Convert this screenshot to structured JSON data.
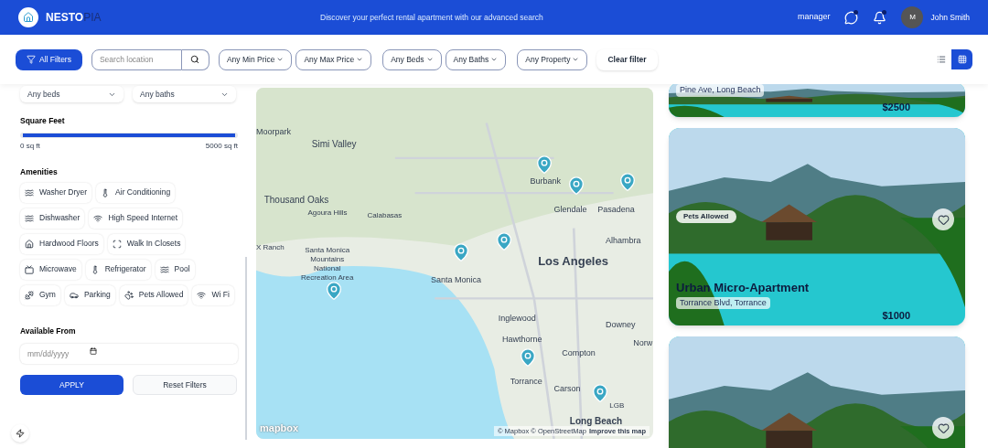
{
  "header": {
    "brand_main": "NESTO",
    "brand_accent": "PIA",
    "tagline": "Discover your perfect rental apartment with our advanced search",
    "role": "manager",
    "user_initial": "M",
    "user_name": "John Smith"
  },
  "toolbar": {
    "all_filters": "All Filters",
    "search": {
      "placeholder": "Search location"
    },
    "dropdowns": [
      "Any Min Price",
      "Any Max Price",
      "Any Beds",
      "Any Baths",
      "Any Property"
    ],
    "clear": "Clear filter",
    "views": [
      {
        "kind": "list",
        "selected": false
      },
      {
        "kind": "grid",
        "selected": true
      }
    ]
  },
  "sidebar": {
    "selects": [
      "Any beds",
      "Any baths"
    ],
    "square_feet": {
      "title": "Square Feet",
      "level": 1,
      "min": "0 sq ft",
      "max": "5000 sq ft"
    },
    "amenities_title": "Amenities",
    "amenities": [
      {
        "label": "Washer Dryer",
        "kind": "waves"
      },
      {
        "label": "Air Conditioning",
        "kind": "thermometer"
      },
      {
        "label": "Dishwasher",
        "kind": "waves"
      },
      {
        "label": "High Speed Internet",
        "kind": "wifi"
      },
      {
        "label": "Hardwood Floors",
        "kind": "home"
      },
      {
        "label": "Walk In Closets",
        "kind": "frame"
      },
      {
        "label": "Microwave",
        "kind": "tv"
      },
      {
        "label": "Refrigerator",
        "kind": "thermometer"
      },
      {
        "label": "Pool",
        "kind": "waves"
      },
      {
        "label": "Gym",
        "kind": "gym"
      },
      {
        "label": "Parking",
        "kind": "car"
      },
      {
        "label": "Pets Allowed",
        "kind": "paw"
      },
      {
        "label": "Wi Fi",
        "kind": "wifi"
      }
    ],
    "available_title": "Available From",
    "date": {
      "placeholder": "mm/dd/yyyy"
    },
    "apply": "APPLY",
    "reset": "Reset Filters"
  },
  "map": {
    "labels": [
      "Moorpark",
      "Simi Valley",
      "Thousand Oaks",
      "Agoura Hills",
      "Calabasas",
      "X Ranch",
      "Santa Monica Mountains National Recreation Area",
      "Burbank",
      "Glendale",
      "Pasadena",
      "Alhambra",
      "Los Angeles",
      "Santa Monica",
      "Inglewood",
      "Downey",
      "Hawthorne",
      "Norw",
      "Compton",
      "Torrance",
      "Carson",
      "LGB",
      "Long Beach"
    ],
    "logo": "mapbox",
    "attribution": "© Mapbox © OpenStreetMap",
    "improve": "Improve this map"
  },
  "listings": [
    {
      "address": "Pine Ave, Long Beach",
      "price": "$2500"
    },
    {
      "tag": "Pets Allowed",
      "title": "Urban Micro-Apartment",
      "address": "Torrance Blvd, Torrance",
      "price": "$1000",
      "favorite": false
    },
    {
      "favorite": false
    }
  ]
}
